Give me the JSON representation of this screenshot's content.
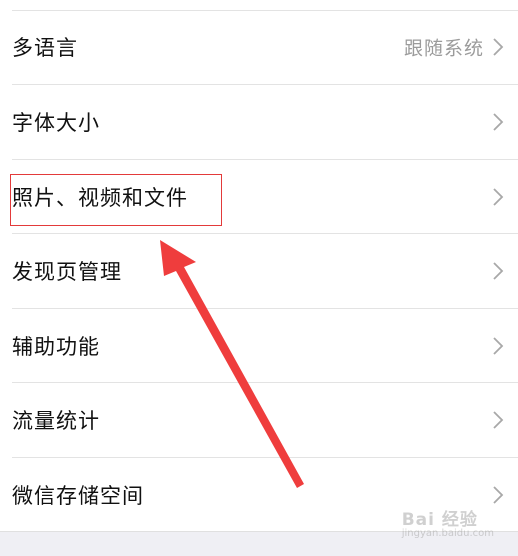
{
  "settings": {
    "items": [
      {
        "label": "多语言",
        "value": "跟随系统"
      },
      {
        "label": "字体大小"
      },
      {
        "label": "照片、视频和文件"
      },
      {
        "label": "发现页管理"
      },
      {
        "label": "辅助功能"
      },
      {
        "label": "流量统计"
      },
      {
        "label": "微信存储空间"
      }
    ]
  },
  "watermark": {
    "text": "Bai 经验",
    "sub": "jingyan.baidu.com"
  },
  "colors": {
    "highlight": "#e33a3a",
    "arrow": "#ef3d3d",
    "divider": "#e3e3e3",
    "secondary_text": "#9b9b9b"
  }
}
